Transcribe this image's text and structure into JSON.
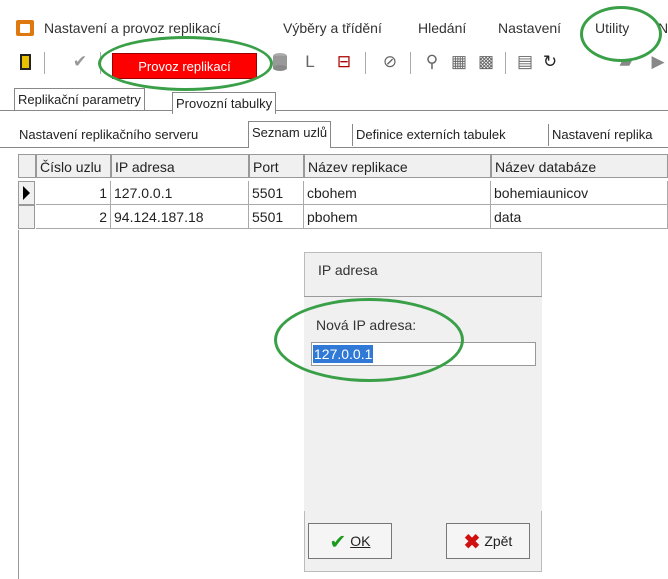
{
  "menu": {
    "items": [
      "Nastavení a provoz replikací",
      "Výběry a třídění",
      "Hledání",
      "Nastavení",
      "Utility",
      "N"
    ]
  },
  "toolbar": {
    "provoz_label": "Provoz replikací",
    "accent_red": "#ff0000"
  },
  "tabs_top": [
    "Replikační parametry",
    "Provozní tabulky"
  ],
  "tabs_sub": [
    "Nastavení replikačního serveru",
    "Seznam uzlů",
    "Definice externích tabulek",
    "Nastavení replika"
  ],
  "grid": {
    "columns": [
      "Číslo uzlu",
      "IP adresa",
      "Port",
      "Název replikace",
      "Název databáze"
    ],
    "rows": [
      [
        "1",
        "127.0.0.1",
        "5501",
        "cbohem",
        "bohemiaunicov"
      ],
      [
        "2",
        "94.124.187.18",
        "5501",
        "pbohem",
        "data"
      ]
    ]
  },
  "dialog": {
    "title": "IP adresa",
    "label": "Nová IP adresa:",
    "value": "127.0.0.1",
    "ok_label": "OK",
    "back_label": "Zpět"
  },
  "annotation_color": "#3aa048"
}
